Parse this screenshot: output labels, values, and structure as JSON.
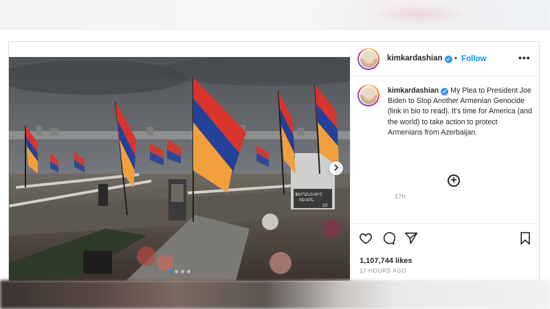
{
  "post": {
    "username": "kimkardashian",
    "verified": true,
    "separator": "•",
    "follow_label": "Follow",
    "more_label": "•••",
    "caption_text": "My Plea to President Joe Biden to Stop Another Armenian Genocide (link in bio to read). It's time for America (and the world) to take action to protect Armenians from Azerbaijan.",
    "time_ago": "17h",
    "likes": "1,107,744 likes",
    "posted_ago": "17 HOURS AGO",
    "carousel": {
      "slides": 4,
      "active_index": 0
    },
    "image_sign_text": [
      "ՖԵՐԱՆԵՎԻՉ",
      "ՏԵՎՈՆ",
      "20"
    ]
  },
  "icons": {
    "verified": "verified-badge-icon",
    "more": "more-options-icon",
    "next": "chevron-right-icon",
    "add_comment": "add-comment-icon",
    "like": "heart-icon",
    "comment": "comment-bubble-icon",
    "share": "paper-plane-icon",
    "save": "bookmark-icon"
  },
  "colors": {
    "accent": "#0095f6",
    "verified": "#3897f0",
    "text": "#262626",
    "muted": "#8e8e8e",
    "flag_red": "#d9342b",
    "flag_blue": "#23409a",
    "flag_orange": "#f2a03d"
  }
}
